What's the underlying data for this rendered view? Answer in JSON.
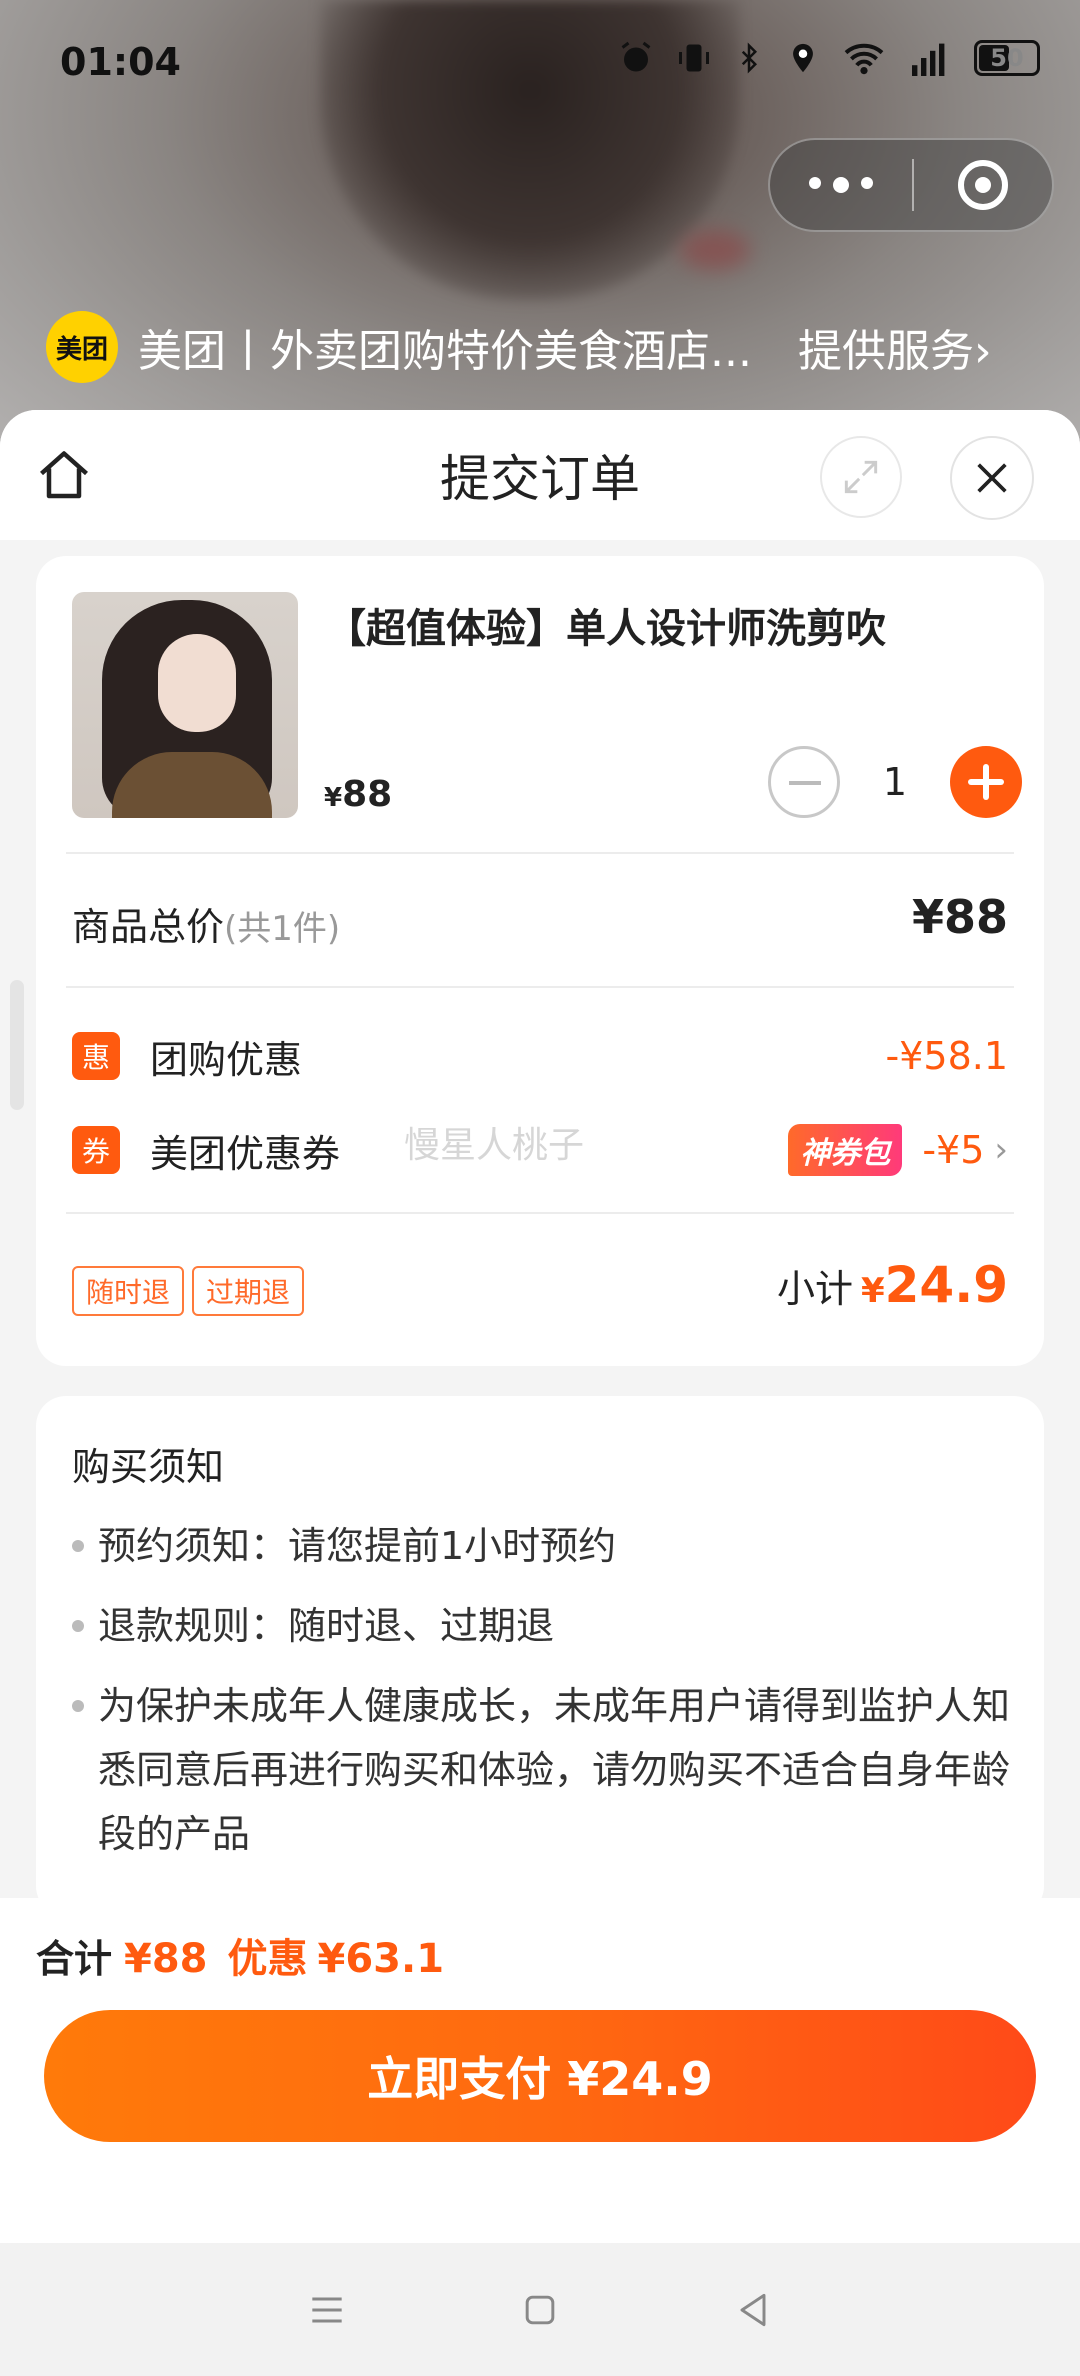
{
  "status": {
    "time": "01:04",
    "battery": "50"
  },
  "miniprogram": {
    "logo": "美团",
    "title": "美团丨外卖团购特价美食酒店...",
    "service": "提供服务",
    "service_chevron": "›"
  },
  "sheet": {
    "title": "提交订单"
  },
  "product": {
    "name": "【超值体验】单人设计师洗剪吹",
    "currency": "¥",
    "price": "88",
    "quantity": "1"
  },
  "summary": {
    "total_label": "商品总价",
    "total_count": "(共1件)",
    "total_value": "¥88"
  },
  "discounts": [
    {
      "icon": "惠",
      "label": "团购优惠",
      "value": "-¥58.1"
    },
    {
      "icon": "券",
      "label": "美团优惠券",
      "tag": "神券包",
      "value": "-¥5",
      "chevron": "›"
    }
  ],
  "watermark": "慢星人桃子",
  "tags": [
    "随时退",
    "过期退"
  ],
  "subtotal": {
    "label": "小计",
    "currency": "¥",
    "value": "24.9"
  },
  "notice": {
    "title": "购买须知",
    "items": [
      "预约须知：请您提前1小时预约",
      "退款规则：随时退、过期退",
      "为保护未成年人健康成长，未成年用户请得到监护人知悉同意后再进行购买和体验，请勿购买不适合自身年龄段的产品"
    ]
  },
  "footer": {
    "total_label": "合计",
    "total_value": "¥88",
    "discount_label": "优惠",
    "discount_value": "¥63.1",
    "pay_label": "立即支付  ¥24.9"
  },
  "colors": {
    "accent": "#ff5a0f",
    "meituan_yellow": "#ffd100"
  },
  "icons": [
    "alarm-icon",
    "vibrate-icon",
    "bluetooth-icon",
    "location-icon",
    "wifi-icon",
    "signal-icon",
    "battery-icon",
    "more-dots-icon",
    "record-icon",
    "home-icon",
    "expand-icon",
    "close-icon",
    "minus-icon",
    "plus-icon",
    "menu-icon",
    "square-icon",
    "back-icon"
  ]
}
